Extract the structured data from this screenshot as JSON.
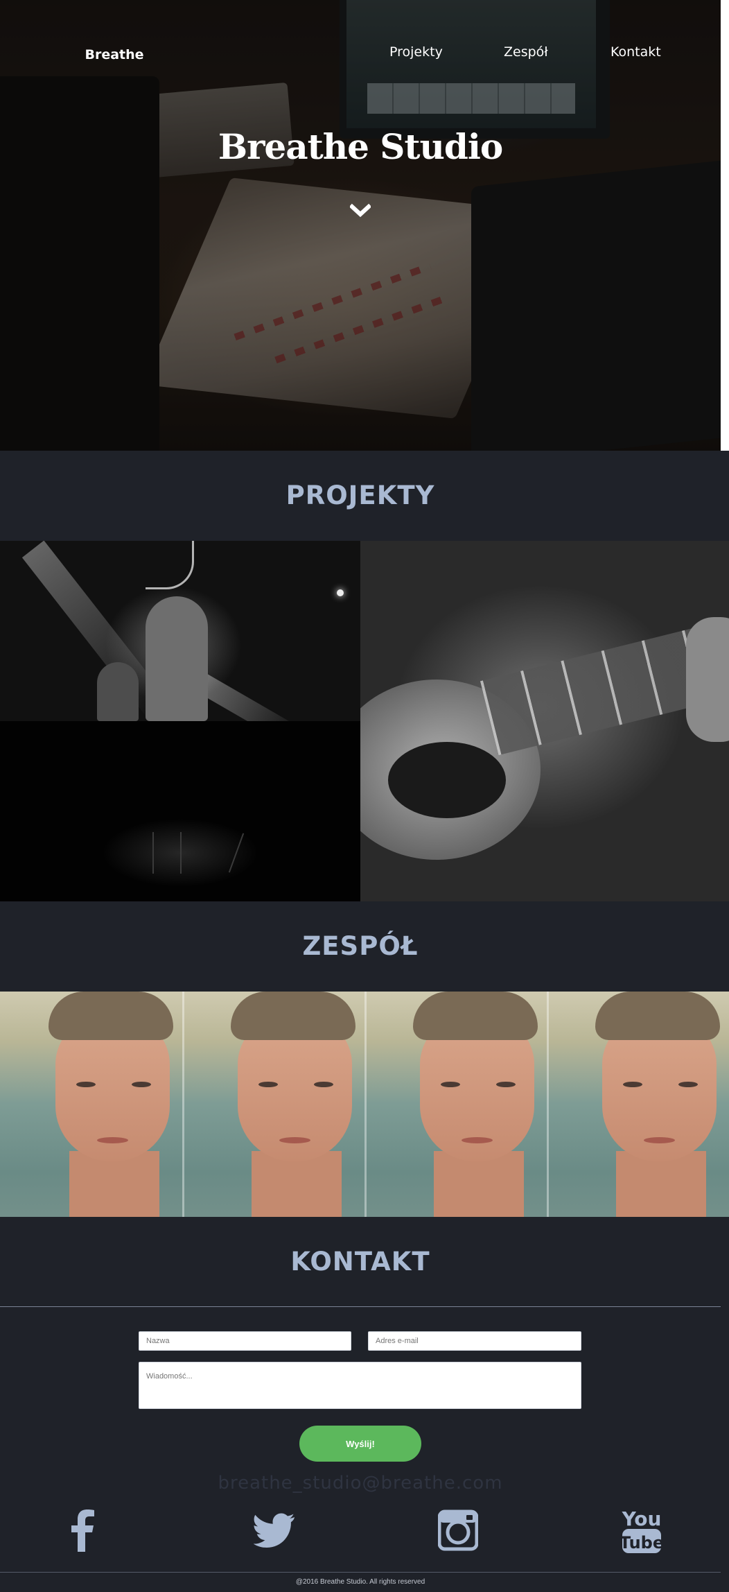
{
  "nav": {
    "brand": "Breathe",
    "links": [
      "Projekty",
      "Zespół",
      "Kontakt"
    ]
  },
  "hero": {
    "title": "Breathe Studio"
  },
  "sections": {
    "projects": "PROJEKTY",
    "team": "ZESPÓŁ",
    "contact": "KONTAKT"
  },
  "contact": {
    "name_placeholder": "Nazwa",
    "email_placeholder": "Adres e-mail",
    "message_placeholder": "Wiadomość...",
    "send_label": "Wyślij!",
    "email": "breathe_studio@breathe.com"
  },
  "social": {
    "youtube_text_top": "You",
    "youtube_text_bottom": "Tube"
  },
  "footer": {
    "copyright": "@2016 Breathe Studio. All rights reserved"
  },
  "colors": {
    "background": "#1f2229",
    "heading": "#a9b9d2",
    "button": "#5cb85c",
    "social_icon": "#a9b9d2"
  }
}
